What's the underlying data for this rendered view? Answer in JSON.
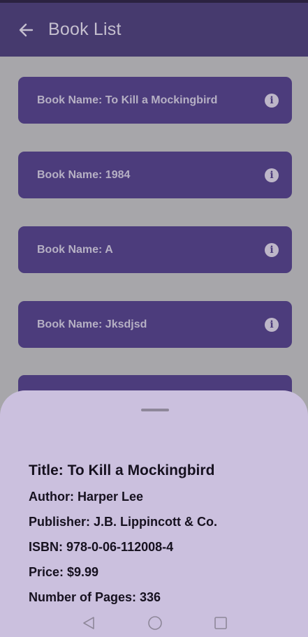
{
  "app_bar": {
    "title": "Book List",
    "back_icon": "arrow-back-icon"
  },
  "books": [
    {
      "label": "Book Name: To Kill a Mockingbird",
      "icon": "info-icon"
    },
    {
      "label": "Book Name: 1984",
      "icon": "info-icon"
    },
    {
      "label": "Book Name: A",
      "icon": "info-icon"
    },
    {
      "label": "Book Name: Jksdjsd",
      "icon": "info-icon"
    },
    {
      "label": "",
      "icon": ""
    }
  ],
  "sheet": {
    "title": "Title: To Kill a Mockingbird",
    "author": "Author: Harper Lee",
    "publisher": "Publisher: J.B. Lippincott & Co.",
    "isbn": "ISBN: 978-0-06-112008-4",
    "price": "Price: $9.99",
    "pages": "Number of Pages: 336"
  },
  "nav": {
    "back": "nav-back-icon",
    "home": "nav-home-icon",
    "recents": "nav-recents-icon"
  },
  "colors": {
    "app_bar": "#463a6e",
    "card": "#4c3c7c",
    "scrim_background": "#a7a6aa",
    "sheet": "#cbc0de"
  }
}
